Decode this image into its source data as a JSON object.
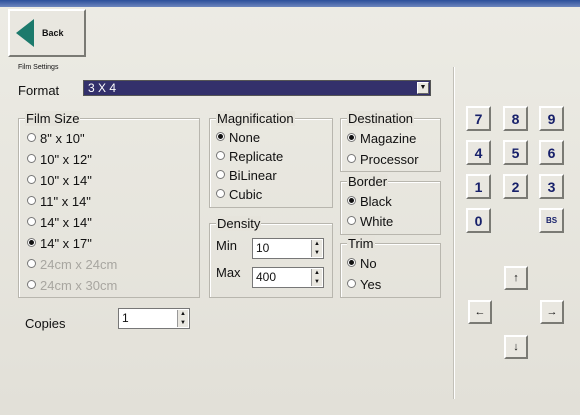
{
  "back_label": "Back",
  "section_title": "Film Settings",
  "format": {
    "label": "Format",
    "value": "3 X 4"
  },
  "film_size": {
    "legend": "Film Size",
    "options": [
      "8\" x 10\"",
      "10\" x 12\"",
      "10\" x 14\"",
      "11\" x 14\"",
      "14\" x 14\"",
      "14\" x 17\"",
      "24cm x 24cm",
      "24cm x 30cm"
    ],
    "selected": "14\" x 17\""
  },
  "magnification": {
    "legend": "Magnification",
    "options": [
      "None",
      "Replicate",
      "BiLinear",
      "Cubic"
    ],
    "selected": "None"
  },
  "density": {
    "legend": "Density",
    "min_label": "Min",
    "min_value": "10",
    "max_label": "Max",
    "max_value": "400"
  },
  "destination": {
    "legend": "Destination",
    "options": [
      "Magazine",
      "Processor"
    ],
    "selected": "Magazine"
  },
  "border": {
    "legend": "Border",
    "options": [
      "Black",
      "White"
    ],
    "selected": "Black"
  },
  "trim": {
    "legend": "Trim",
    "options": [
      "No",
      "Yes"
    ],
    "selected": "No"
  },
  "copies": {
    "label": "Copies",
    "value": "1"
  },
  "keypad": {
    "keys": [
      "7",
      "8",
      "9",
      "4",
      "5",
      "6",
      "1",
      "2",
      "3",
      "0",
      "BS"
    ]
  },
  "nav": {
    "up": "↑",
    "left": "←",
    "right": "→",
    "down": "↓"
  },
  "colors": {
    "format_select_bg": "#33306b",
    "back_arrow": "#1c7a6c",
    "key_text": "#17206a",
    "title_band": "#2b4f9a"
  }
}
